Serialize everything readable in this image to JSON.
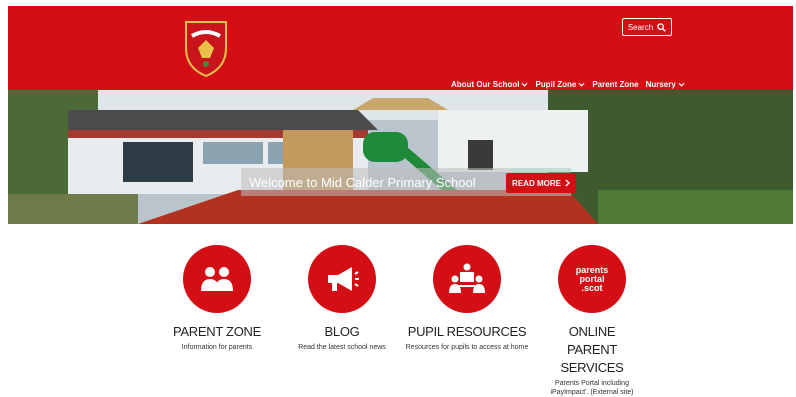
{
  "header": {
    "search_label": "Search",
    "crest_icon": "school-crest-icon",
    "nav": [
      {
        "label": "About Our School",
        "dropdown": true
      },
      {
        "label": "Pupil Zone",
        "dropdown": true
      },
      {
        "label": "Parent Zone",
        "dropdown": false
      },
      {
        "label": "Nursery",
        "dropdown": true
      }
    ]
  },
  "hero": {
    "welcome_text": "Welcome to Mid Calder Primary School",
    "read_more_label": "READ MORE"
  },
  "tiles": [
    {
      "title": "PARENT ZONE",
      "desc": "Information for parents",
      "icon": "parents-icon"
    },
    {
      "title": "BLOG",
      "desc": "Read the latest school news",
      "icon": "megaphone-icon"
    },
    {
      "title": "PUPIL RESOURCES",
      "desc": "Resources for pupils to access at home",
      "icon": "pupils-icon"
    },
    {
      "title": "ONLINE PARENT SERVICES",
      "desc": "Parents Portal including iPayImpact'. (External site)",
      "icon": "parents-portal-icon",
      "icon_text": "parents portal .scot"
    }
  ],
  "colors": {
    "brand_red": "#d30f15"
  }
}
